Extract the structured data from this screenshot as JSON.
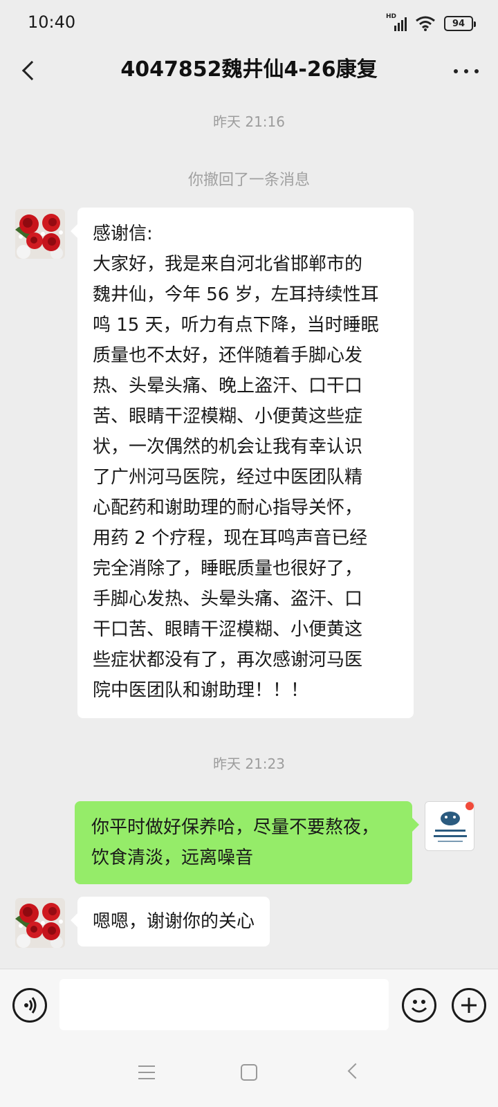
{
  "status_bar": {
    "time": "10:40",
    "network_label": "HD",
    "battery": "94",
    "icons": [
      "signal-icon",
      "wifi-icon",
      "battery-icon"
    ]
  },
  "header": {
    "title": "4047852魏井仙4-26康复",
    "back_icon": "chevron-left-icon",
    "more_icon": "more-dots-icon"
  },
  "messages": {
    "timestamp_1": "昨天 21:16",
    "recalled": "你撤回了一条消息",
    "letter_lines": [
      "感谢信:",
      "大家好，我是来自河北省邯郸市的",
      "魏井仙，今年 56 岁，左耳持续性耳",
      "鸣 15 天，听力有点下降，当时睡眠",
      "质量也不太好，还伴随着手脚心发",
      "热、头晕头痛、晚上盗汗、口干口",
      "苦、眼睛干涩模糊、小便黄这些症",
      "状，一次偶然的机会让我有幸认识",
      "了广州河马医院，经过中医团队精",
      "心配药和谢助理的耐心指导关怀，",
      "用药 2 个疗程，现在耳鸣声音已经",
      "完全消除了，睡眠质量也很好了，",
      "手脚心发热、头晕头痛、盗汗、口",
      "干口苦、眼睛干涩模糊、小便黄这",
      "些症状都没有了，再次感谢河马医",
      "院中医团队和谢助理！！！"
    ],
    "timestamp_2": "昨天 21:23",
    "reply_lines": [
      "你平时做好保养哈，尽量不要熬夜，",
      "饮食清淡，远离噪音"
    ],
    "last_message": "嗯嗯，谢谢你的关心"
  },
  "colors": {
    "background": "#ededed",
    "bubble_self": "#95ec69",
    "bubble_other": "#ffffff",
    "unread_dot": "#f04a3a"
  },
  "input_bar": {
    "icons": [
      "voice-icon",
      "emoji-icon",
      "plus-icon"
    ]
  },
  "nav_bar": {
    "icons": [
      "menu-icon",
      "home-icon",
      "back-icon"
    ]
  }
}
